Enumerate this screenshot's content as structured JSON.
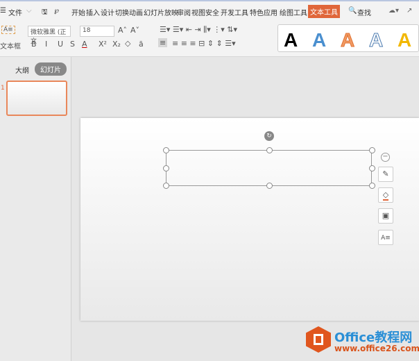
{
  "menu": {
    "hamburger": "☰",
    "file": "文件",
    "tabs": [
      "开始",
      "插入",
      "设计",
      "切换",
      "动画",
      "幻灯片放映",
      "审阅",
      "视图",
      "安全",
      "开发工具",
      "特色应用",
      "绘图工具",
      "文本工具"
    ],
    "active_tab": "文本工具",
    "search": "查找"
  },
  "ribbon": {
    "textbox_label": "文本框",
    "font_name": "微软雅黑 (正文",
    "font_size": "18",
    "bold": "B",
    "italic": "I",
    "underline": "U",
    "strike": "S",
    "font_color": "A",
    "superscript": "X²",
    "subscript": "X₂",
    "clear": "◇",
    "char": "ā",
    "wordart": [
      "A",
      "A",
      "A",
      "A",
      "A"
    ]
  },
  "left_panel": {
    "tab_outline": "大纲",
    "tab_slides": "幻灯片",
    "slide_number": "1"
  },
  "watermark": {
    "brand": "Office教程网",
    "url": "www.office26.com"
  },
  "colors": {
    "accent": "#e0663a",
    "wordart": [
      "#000000",
      "#4a8fcf",
      "#f19a63",
      "#ffffff",
      "#f2b700"
    ]
  }
}
